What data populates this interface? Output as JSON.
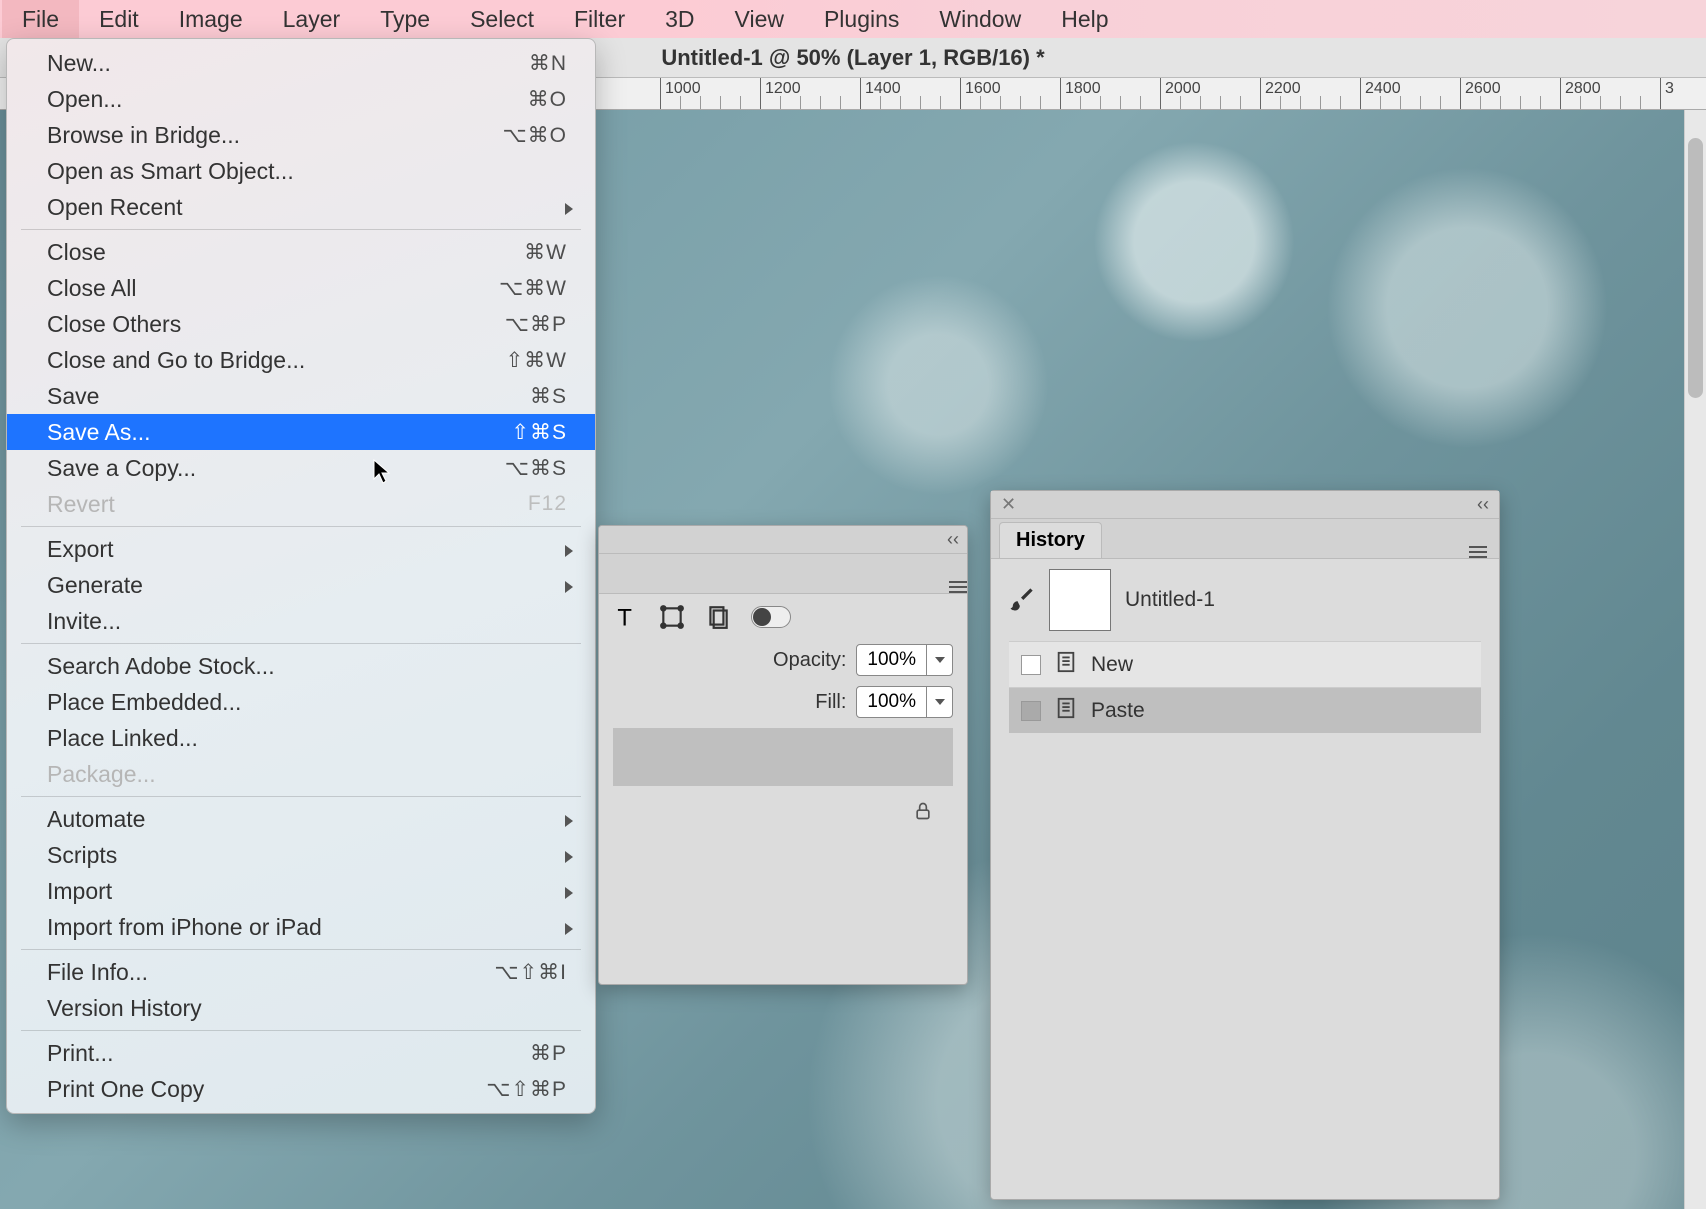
{
  "menubar": {
    "items": [
      "File",
      "Edit",
      "Image",
      "Layer",
      "Type",
      "Select",
      "Filter",
      "3D",
      "View",
      "Plugins",
      "Window",
      "Help"
    ],
    "active_index": 0
  },
  "document": {
    "title": "Untitled-1 @ 50% (Layer 1, RGB/16) *"
  },
  "ruler": {
    "ticks": [
      "1000",
      "1200",
      "1400",
      "1600",
      "1800",
      "2000",
      "2200",
      "2400",
      "2600",
      "2800"
    ]
  },
  "file_menu": {
    "groups": [
      [
        {
          "label": "New...",
          "shortcut": "⌘N"
        },
        {
          "label": "Open...",
          "shortcut": "⌘O"
        },
        {
          "label": "Browse in Bridge...",
          "shortcut": "⌥⌘O"
        },
        {
          "label": "Open as Smart Object..."
        },
        {
          "label": "Open Recent",
          "submenu": true
        }
      ],
      [
        {
          "label": "Close",
          "shortcut": "⌘W"
        },
        {
          "label": "Close All",
          "shortcut": "⌥⌘W"
        },
        {
          "label": "Close Others",
          "shortcut": "⌥⌘P"
        },
        {
          "label": "Close and Go to Bridge...",
          "shortcut": "⇧⌘W"
        },
        {
          "label": "Save",
          "shortcut": "⌘S"
        },
        {
          "label": "Save As...",
          "shortcut": "⇧⌘S",
          "selected": true
        },
        {
          "label": "Save a Copy...",
          "shortcut": "⌥⌘S"
        },
        {
          "label": "Revert",
          "shortcut": "F12",
          "disabled": true
        }
      ],
      [
        {
          "label": "Export",
          "submenu": true
        },
        {
          "label": "Generate",
          "submenu": true
        },
        {
          "label": "Invite..."
        }
      ],
      [
        {
          "label": "Search Adobe Stock..."
        },
        {
          "label": "Place Embedded..."
        },
        {
          "label": "Place Linked..."
        },
        {
          "label": "Package...",
          "disabled": true
        }
      ],
      [
        {
          "label": "Automate",
          "submenu": true
        },
        {
          "label": "Scripts",
          "submenu": true
        },
        {
          "label": "Import",
          "submenu": true
        },
        {
          "label": "Import from iPhone or iPad",
          "submenu": true
        }
      ],
      [
        {
          "label": "File Info...",
          "shortcut": "⌥⇧⌘I"
        },
        {
          "label": "Version History"
        }
      ],
      [
        {
          "label": "Print...",
          "shortcut": "⌘P"
        },
        {
          "label": "Print One Copy",
          "shortcut": "⌥⇧⌘P"
        }
      ]
    ]
  },
  "layers_panel": {
    "opacity_label": "Opacity:",
    "opacity_value": "100%",
    "fill_label": "Fill:",
    "fill_value": "100%"
  },
  "history_panel": {
    "tab": "History",
    "doc_name": "Untitled-1",
    "rows": [
      {
        "label": "New",
        "active": false
      },
      {
        "label": "Paste",
        "active": true
      }
    ]
  }
}
